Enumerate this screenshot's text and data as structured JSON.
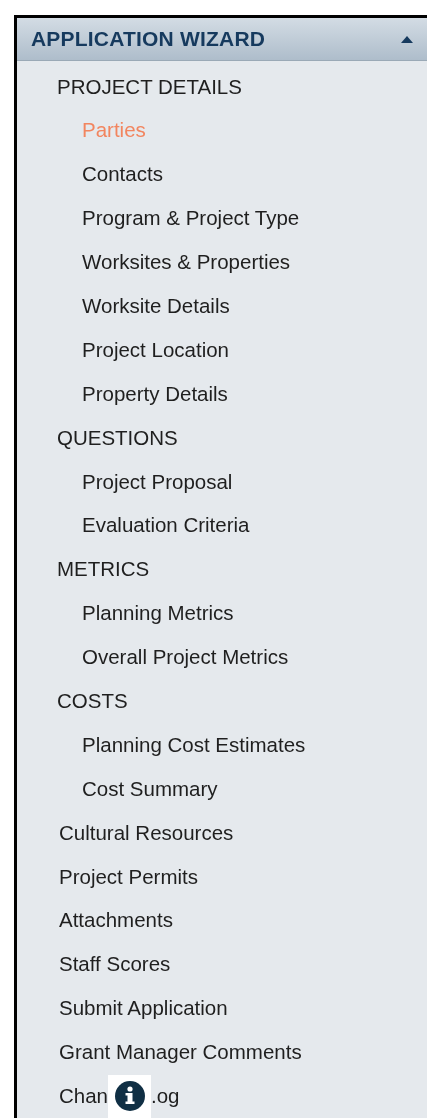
{
  "panel": {
    "title": "APPLICATION WIZARD",
    "expanded": true
  },
  "nav": [
    {
      "kind": "section",
      "label": "PROJECT DETAILS",
      "children": [
        {
          "label": "Parties",
          "selected": true
        },
        {
          "label": "Contacts",
          "selected": false
        },
        {
          "label": "Program & Project Type",
          "selected": false
        },
        {
          "label": "Worksites & Properties",
          "selected": false
        },
        {
          "label": "Worksite Details",
          "selected": false
        },
        {
          "label": "Project Location",
          "selected": false
        },
        {
          "label": "Property Details",
          "selected": false
        }
      ]
    },
    {
      "kind": "section",
      "label": "QUESTIONS",
      "children": [
        {
          "label": "Project Proposal",
          "selected": false
        },
        {
          "label": "Evaluation Criteria",
          "selected": false
        }
      ]
    },
    {
      "kind": "section",
      "label": "METRICS",
      "children": [
        {
          "label": "Planning Metrics",
          "selected": false
        },
        {
          "label": "Overall Project Metrics",
          "selected": false
        }
      ]
    },
    {
      "kind": "section",
      "label": "COSTS",
      "children": [
        {
          "label": "Planning Cost Estimates",
          "selected": false
        },
        {
          "label": "Cost Summary",
          "selected": false
        }
      ]
    },
    {
      "kind": "item",
      "label": "Cultural Resources",
      "selected": false
    },
    {
      "kind": "item",
      "label": "Project Permits",
      "selected": false
    },
    {
      "kind": "item",
      "label": "Attachments",
      "selected": false
    },
    {
      "kind": "item",
      "label": "Staff Scores",
      "selected": false
    },
    {
      "kind": "item",
      "label": "Submit Application",
      "selected": false
    },
    {
      "kind": "item",
      "label": "Grant Manager Comments",
      "selected": false
    },
    {
      "kind": "covered",
      "label_start": "Chan",
      "label_end": ".og",
      "selected": false
    }
  ]
}
